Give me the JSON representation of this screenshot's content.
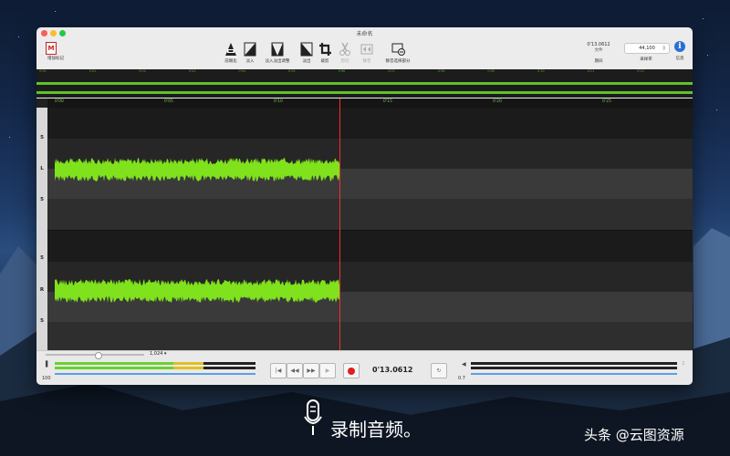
{
  "window": {
    "title": "未命名"
  },
  "toolbar": {
    "left": {
      "label": "增加标记",
      "badge": "M"
    },
    "items": [
      {
        "label": "前端化"
      },
      {
        "label": "淡入"
      },
      {
        "label": "淡入淡出调整"
      },
      {
        "label": "淡出"
      },
      {
        "label": "裁剪"
      },
      {
        "label": "剪切"
      },
      {
        "label": "静音"
      },
      {
        "label": "静音选择部分"
      }
    ],
    "duration": {
      "value": "0'13.0612",
      "unit": "文件",
      "label": "期间"
    },
    "rate": {
      "value": "44,100",
      "label": "采样率"
    },
    "info": {
      "label": "信息"
    }
  },
  "overview": {
    "ticks": [
      "0'00",
      "0'01",
      "0'02",
      "0'03",
      "0'04",
      "0'05",
      "0'06",
      "0'07",
      "0'08",
      "0'09",
      "0'10",
      "0'11",
      "0'12"
    ]
  },
  "ruler": {
    "ticks": [
      "0'00",
      "0'05",
      "0'10",
      "0'15",
      "0'20",
      "0'25"
    ]
  },
  "channels": {
    "left": {
      "label": "L",
      "top": "5",
      "bottom": "5"
    },
    "right": {
      "label": "R",
      "top": "5",
      "bottom": "5"
    }
  },
  "zoom": {
    "value": "1,024"
  },
  "transport": {
    "time": "0'13.0612",
    "left_level": "100",
    "right_level": "0.7"
  },
  "caption": "录制音频。",
  "watermark": "头条 @云图资源",
  "colors": {
    "wave": "#7fe21d",
    "playhead": "#e33333",
    "record": "#e01e1e",
    "info": "#2b6fd6"
  }
}
